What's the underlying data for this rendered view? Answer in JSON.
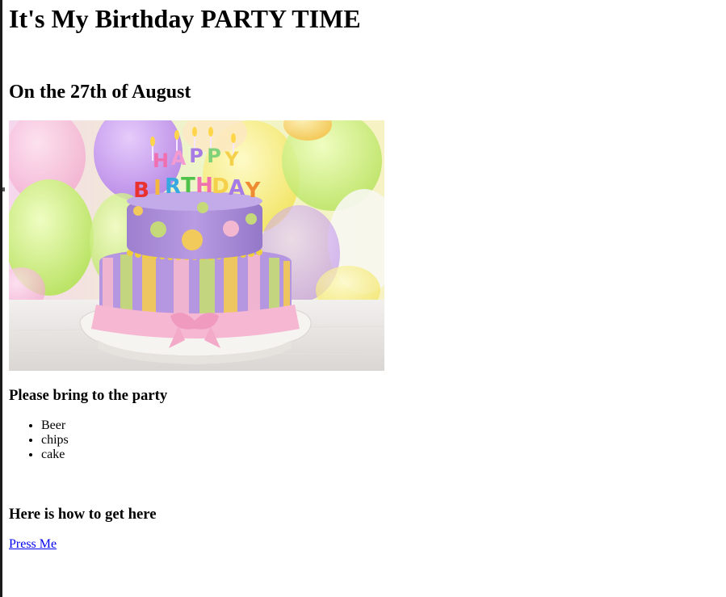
{
  "page": {
    "title": "It's My Birthday PARTY TIME",
    "subtitle": "On the 27th of August"
  },
  "image": {
    "candle_letters": [
      "H",
      "A",
      "P",
      "P",
      "Y",
      "B",
      "I",
      "R",
      "T",
      "H",
      "D",
      "A",
      "Y"
    ]
  },
  "bring": {
    "heading": "Please bring to the party",
    "items": [
      "Beer",
      "chips",
      "cake"
    ]
  },
  "directions": {
    "heading": "Here is how to get here",
    "link_label": "Press Me"
  },
  "colors": {
    "link": "#0000ee",
    "text": "#000000",
    "cake_purple": "#a88bd8",
    "cake_pink": "#f4b6cf",
    "cake_yellow": "#f3cd5b",
    "cake_green": "#b6d873"
  }
}
